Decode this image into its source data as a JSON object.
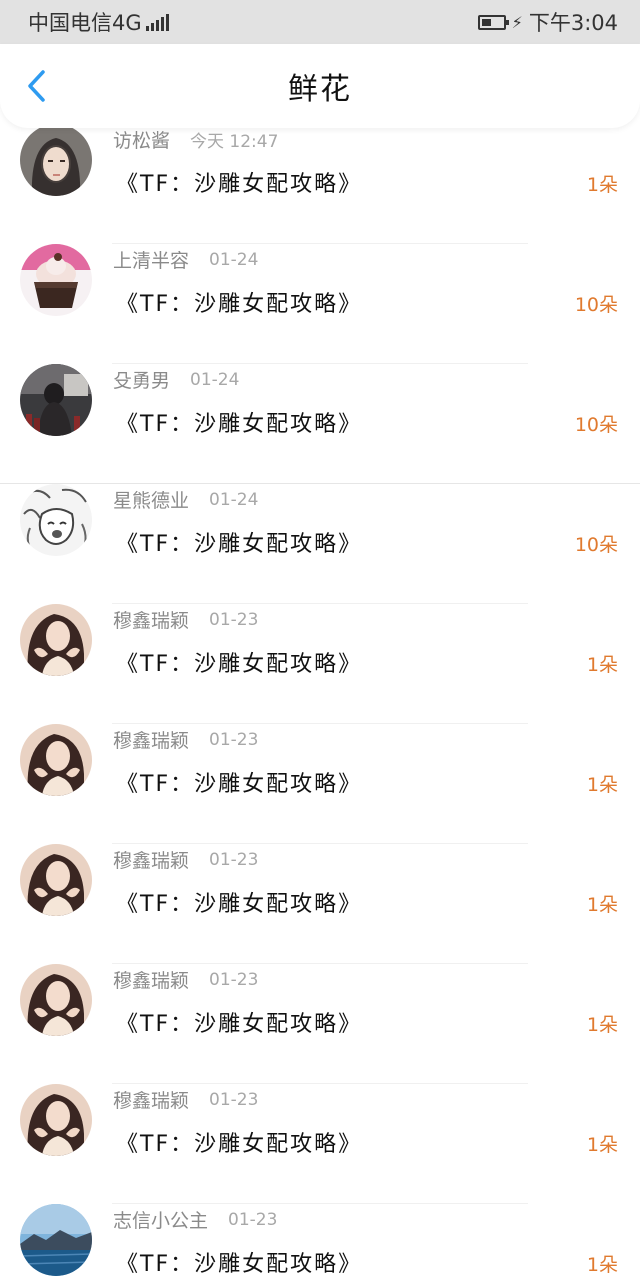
{
  "status_bar": {
    "carrier": "中国电信4G",
    "network_badge": "4G",
    "time": "下午3:04"
  },
  "header": {
    "title": "鲜花",
    "back_icon": "chevron-left-icon",
    "accent_color": "#2e9bf0"
  },
  "list": {
    "count_color": "#e07a2f",
    "items": [
      {
        "name": "访松酱",
        "time": "今天 12:47",
        "book": "《TF：沙雕女配攻略》",
        "count": "1朵",
        "avatar": "portrait"
      },
      {
        "name": "上清半容",
        "time": "01-24",
        "book": "《TF：沙雕女配攻略》",
        "count": "10朵",
        "avatar": "cupcake"
      },
      {
        "name": "殳勇男",
        "time": "01-24",
        "book": "《TF：沙雕女配攻略》",
        "count": "10朵",
        "avatar": "dark-room"
      },
      {
        "name": "星熊德业",
        "time": "01-24",
        "book": "《TF：沙雕女配攻略》",
        "count": "10朵",
        "avatar": "anime-sketch"
      },
      {
        "name": "穆鑫瑞颖",
        "time": "01-23",
        "book": "《TF：沙雕女配攻略》",
        "count": "1朵",
        "avatar": "heart-hands"
      },
      {
        "name": "穆鑫瑞颖",
        "time": "01-23",
        "book": "《TF：沙雕女配攻略》",
        "count": "1朵",
        "avatar": "heart-hands"
      },
      {
        "name": "穆鑫瑞颖",
        "time": "01-23",
        "book": "《TF：沙雕女配攻略》",
        "count": "1朵",
        "avatar": "heart-hands"
      },
      {
        "name": "穆鑫瑞颖",
        "time": "01-23",
        "book": "《TF：沙雕女配攻略》",
        "count": "1朵",
        "avatar": "heart-hands"
      },
      {
        "name": "穆鑫瑞颖",
        "time": "01-23",
        "book": "《TF：沙雕女配攻略》",
        "count": "1朵",
        "avatar": "heart-hands"
      },
      {
        "name": "志信小公主",
        "time": "01-23",
        "book": "《TF：沙雕女配攻略》",
        "count": "1朵",
        "avatar": "lake-landscape"
      }
    ]
  }
}
